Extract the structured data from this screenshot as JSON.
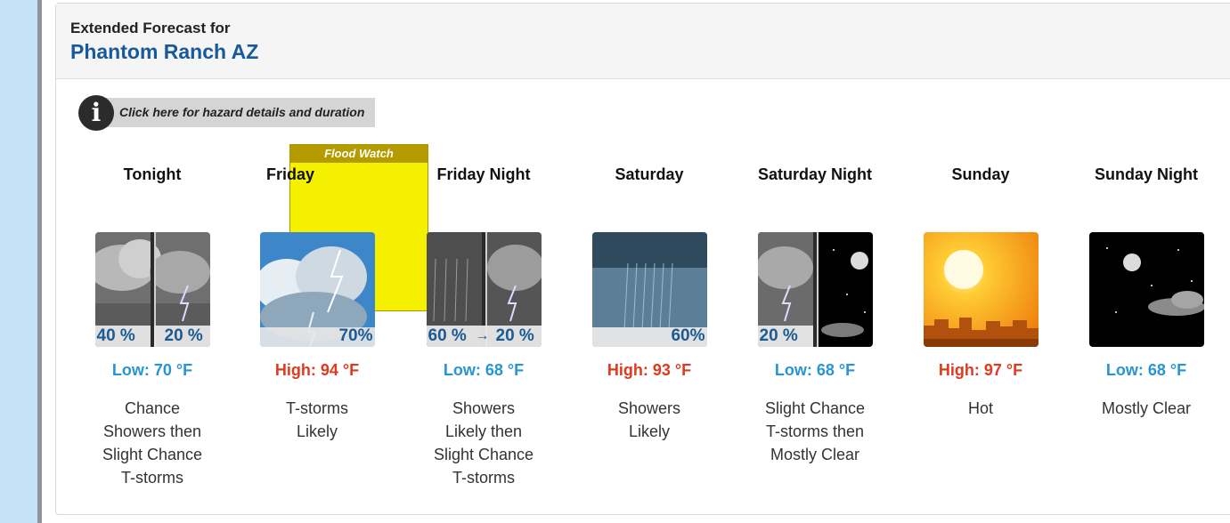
{
  "header": {
    "label": "Extended Forecast for",
    "location": "Phantom Ranch AZ"
  },
  "hazard": {
    "button_text": "Click here for hazard details and duration",
    "button_icon": "info-icon",
    "watch_label": "Flood Watch",
    "watch_color": "#f5f000"
  },
  "periods": [
    {
      "name": "Tonight",
      "temp": "Low: 70 °F",
      "temp_type": "low",
      "desc": [
        "Chance",
        "Showers then",
        "Slight Chance",
        "T-storms"
      ],
      "precip": [
        "40 %",
        "20 %"
      ],
      "icon": "showers-tstorms-split-icon"
    },
    {
      "name": "Friday",
      "temp": "High: 94 °F",
      "temp_type": "high",
      "desc": [
        "T-storms",
        "Likely"
      ],
      "precip": [
        "70%"
      ],
      "icon": "tstorms-icon"
    },
    {
      "name": "Friday Night",
      "temp": "Low: 68 °F",
      "temp_type": "low",
      "desc": [
        "Showers",
        "Likely then",
        "Slight Chance",
        "T-storms"
      ],
      "precip": [
        "60 %",
        "20 %"
      ],
      "icon": "showers-tstorms-split-icon"
    },
    {
      "name": "Saturday",
      "temp": "High: 93 °F",
      "temp_type": "high",
      "desc": [
        "Showers",
        "Likely"
      ],
      "precip": [
        "60%"
      ],
      "icon": "showers-icon"
    },
    {
      "name": "Saturday Night",
      "temp": "Low: 68 °F",
      "temp_type": "low",
      "desc": [
        "Slight Chance",
        "T-storms then",
        "Mostly Clear"
      ],
      "precip": [
        "20 %"
      ],
      "icon": "tstorms-clear-night-split-icon"
    },
    {
      "name": "Sunday",
      "temp": "High: 97 °F",
      "temp_type": "high",
      "desc": [
        "Hot"
      ],
      "precip": [],
      "icon": "hot-sun-icon"
    },
    {
      "name": "Sunday Night",
      "temp": "Low: 68 °F",
      "temp_type": "low",
      "desc": [
        "Mostly Clear"
      ],
      "precip": [],
      "icon": "clear-night-icon"
    }
  ]
}
